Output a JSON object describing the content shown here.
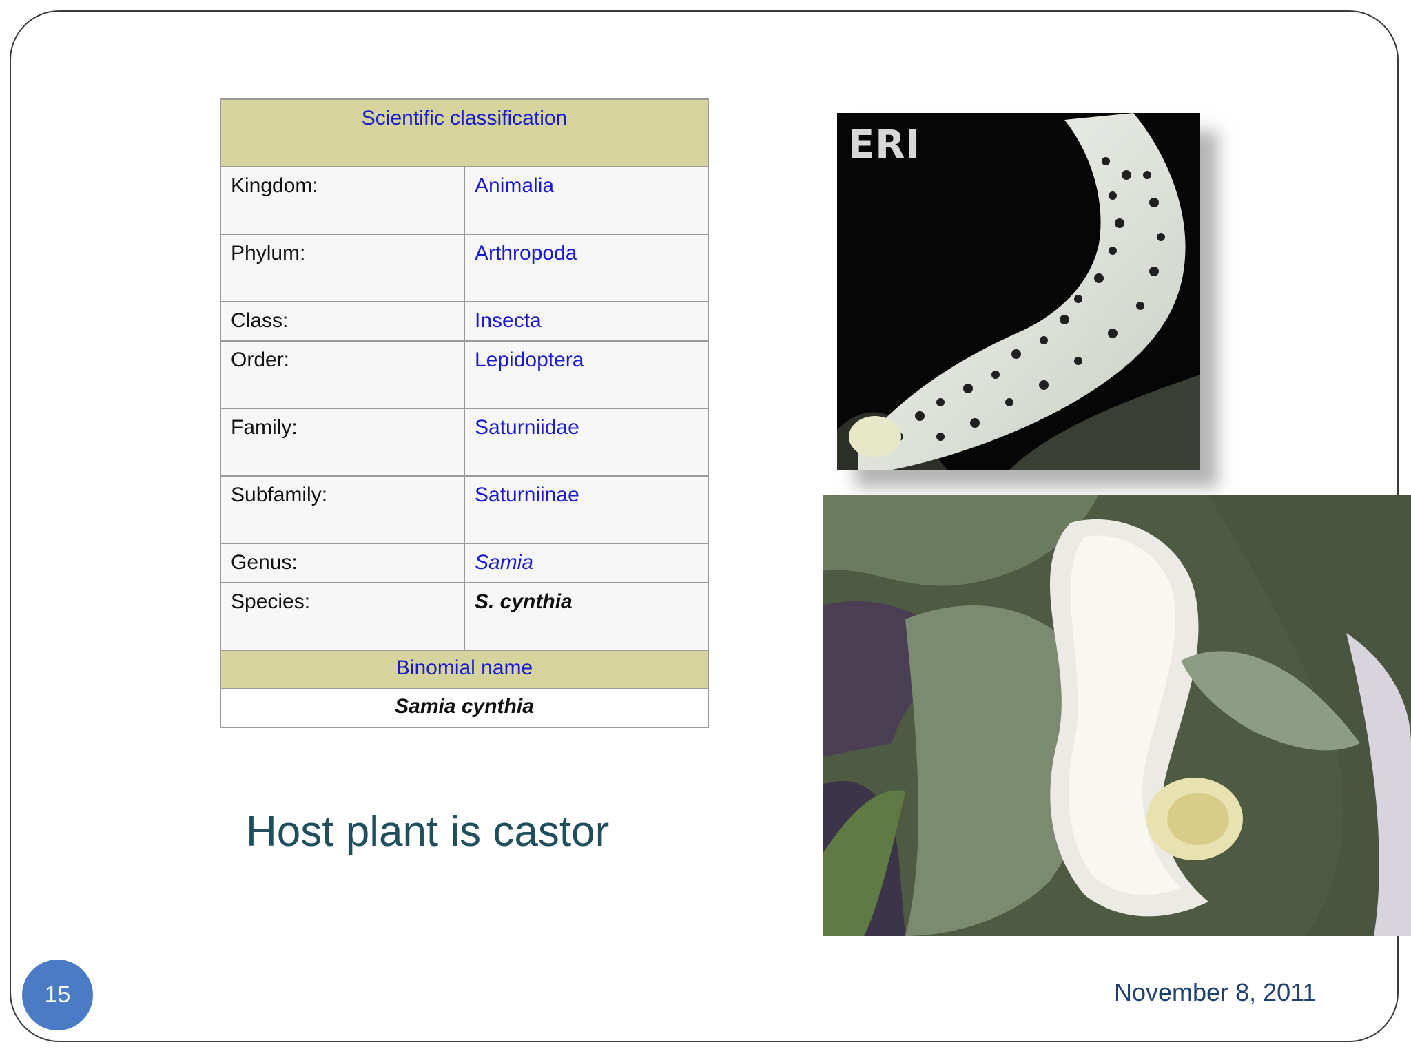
{
  "classification": {
    "header": "Scientific classification",
    "rows": [
      {
        "rank": "Kingdom:",
        "value": "Animalia"
      },
      {
        "rank": "Phylum:",
        "value": "Arthropoda"
      },
      {
        "rank": "Class:",
        "value": "Insecta"
      },
      {
        "rank": "Order:",
        "value": "Lepidoptera"
      },
      {
        "rank": "Family:",
        "value": "Saturniidae"
      },
      {
        "rank": "Subfamily:",
        "value": "Saturniinae"
      },
      {
        "rank": "Genus:",
        "value": "Samia"
      },
      {
        "rank": "Species:",
        "value": "S. cynthia"
      }
    ],
    "binomial_header": "Binomial name",
    "binomial_value": "Samia cynthia"
  },
  "host_text": "Host plant is castor",
  "photo_label": "ERI",
  "slide_number": "15",
  "date": "November 8, 2011",
  "colors": {
    "header_fill": "#d4d49c",
    "link_blue": "#1a1ad0",
    "title_teal": "#1f4f5e",
    "badge_blue": "#4a7bc4"
  }
}
